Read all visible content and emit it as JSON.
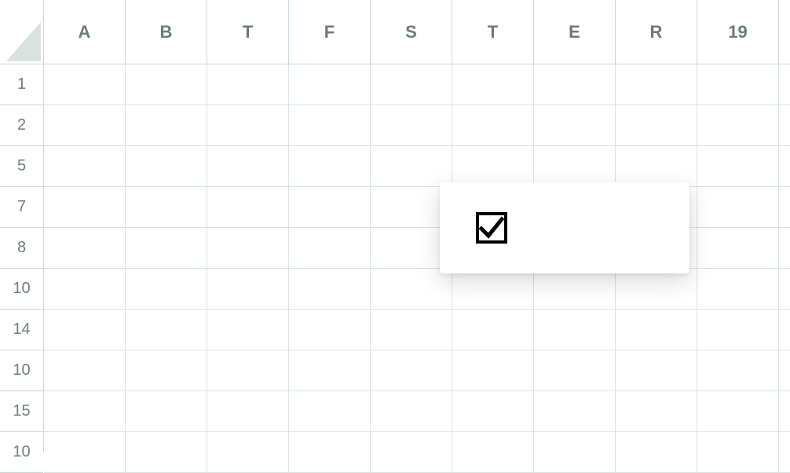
{
  "column_headers": [
    "A",
    "B",
    "T",
    "F",
    "S",
    "T",
    "E",
    "R",
    "19"
  ],
  "row_headers": [
    "1",
    "2",
    "5",
    "7",
    "8",
    "10",
    "14",
    "10",
    "15",
    "10"
  ],
  "popup": {
    "checkbox_checked": true
  }
}
